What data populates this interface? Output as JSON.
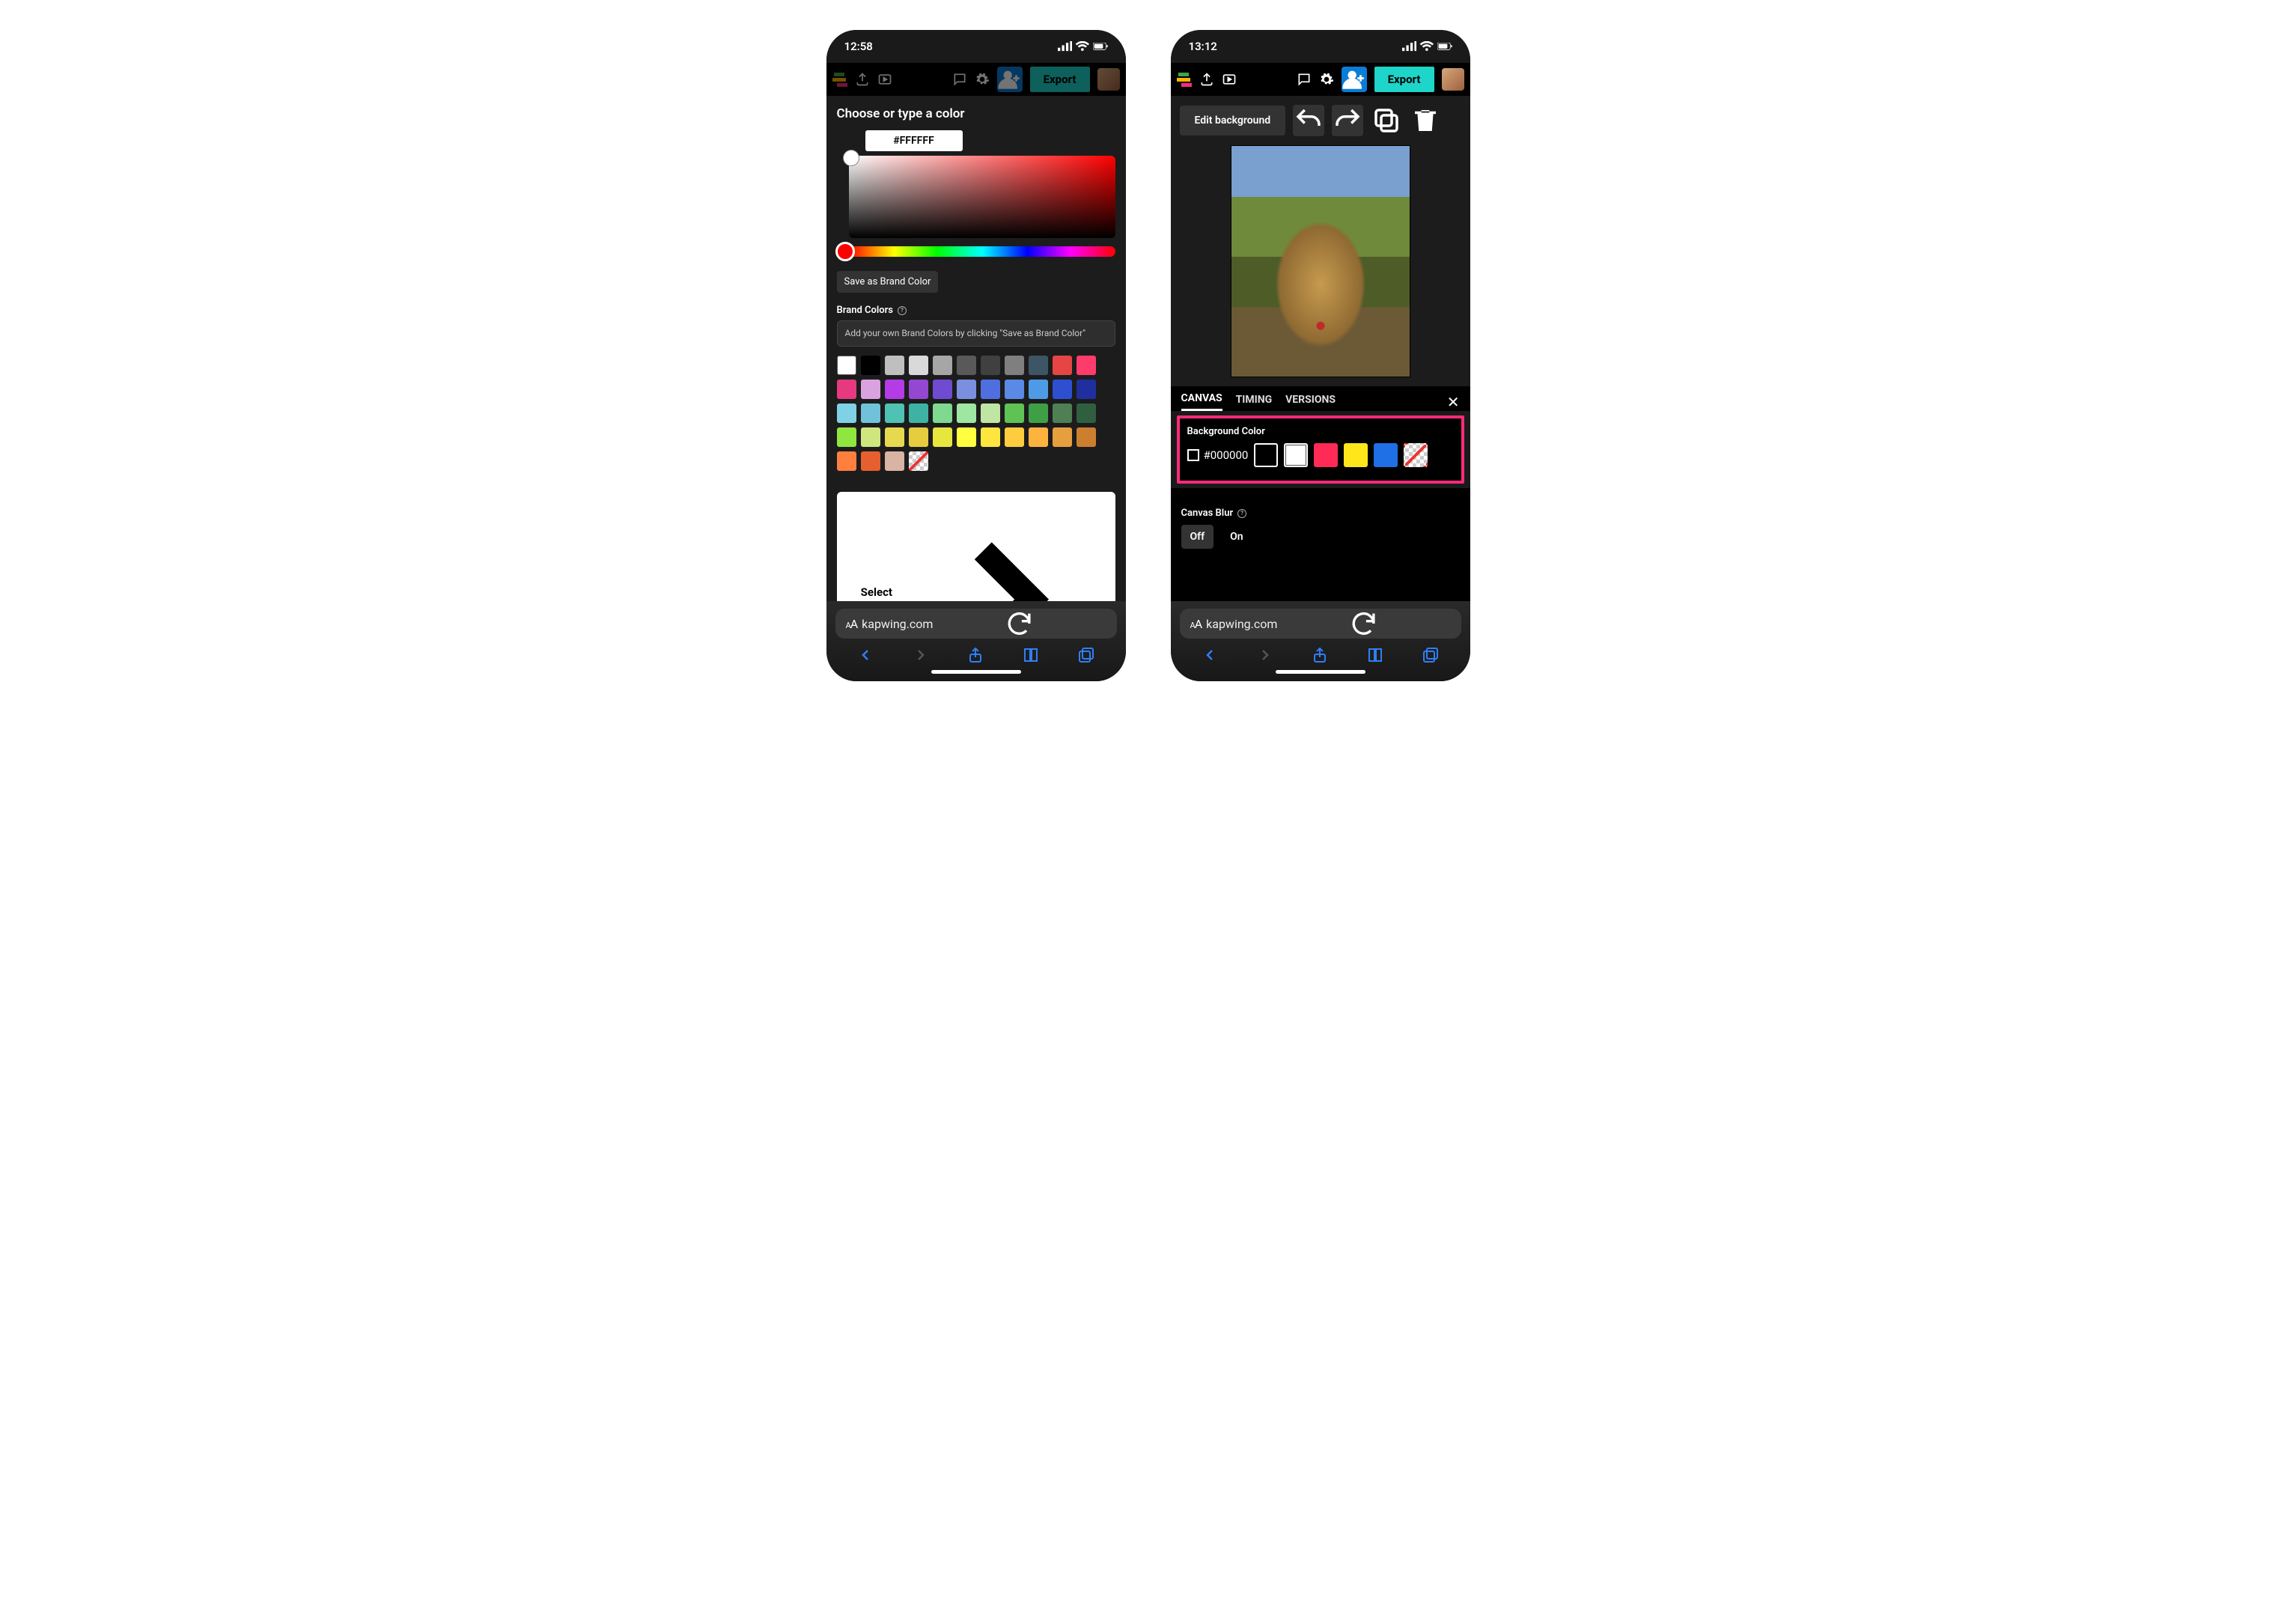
{
  "left": {
    "time": "12:58",
    "panel_title": "Choose or type a color",
    "hex_value": "#FFFFFF",
    "save_brand": "Save as Brand Color",
    "brand_label": "Brand Colors",
    "brand_hint": "Add your own Brand Colors by clicking \"Save as Brand Color\"",
    "select_label": "Select #FFFFFF",
    "url": "kapwing.com",
    "toolbar": {
      "export": "Export"
    }
  },
  "right": {
    "time": "13:12",
    "toolbar": {
      "export": "Export"
    },
    "edit_bg": "Edit background",
    "tabs": {
      "canvas": "CANVAS",
      "timing": "TIMING",
      "versions": "VERSIONS"
    },
    "bg_label": "Background Color",
    "bg_hex": "#000000",
    "blur_label": "Canvas Blur",
    "blur_off": "Off",
    "blur_on": "On",
    "url": "kapwing.com"
  },
  "swatches": [
    "#ffffff",
    "#000000",
    "#bfbfbf",
    "#d9d9d9",
    "#a6a6a6",
    "#595959",
    "#404040",
    "#7f7f7f",
    "#3e5566",
    "#e64545",
    "#ff3b6b",
    "#e6397f",
    "#d9a3e0",
    "#b53be6",
    "#9447d1",
    "#6f4bd1",
    "#7a8fe0",
    "#4f6fe0",
    "#5a8ae6",
    "#4f9ae6",
    "#2f4fd1",
    "#1f2fa0",
    "#7fd1e6",
    "#6fc2d9",
    "#4fc2b3",
    "#3fb3a3",
    "#7fd98f",
    "#9fe6a3",
    "#bfe6a3",
    "#5fc255",
    "#3f9f45",
    "#4f7f55",
    "#2f5f3f",
    "#8fe63f",
    "#cfe67f",
    "#e6d94f",
    "#e6cc3f",
    "#e6e63f",
    "#ffff3f",
    "#ffe63f",
    "#ffcc3f",
    "#ffb33f",
    "#e69f3f",
    "#cc7f2f",
    "#ff7f3f",
    "#e65f2f",
    "#d9b3a3"
  ],
  "bg_swatches": [
    "#000000",
    "#ffffff",
    "#ff2a55",
    "#ffe61a",
    "#1f6fe6"
  ]
}
